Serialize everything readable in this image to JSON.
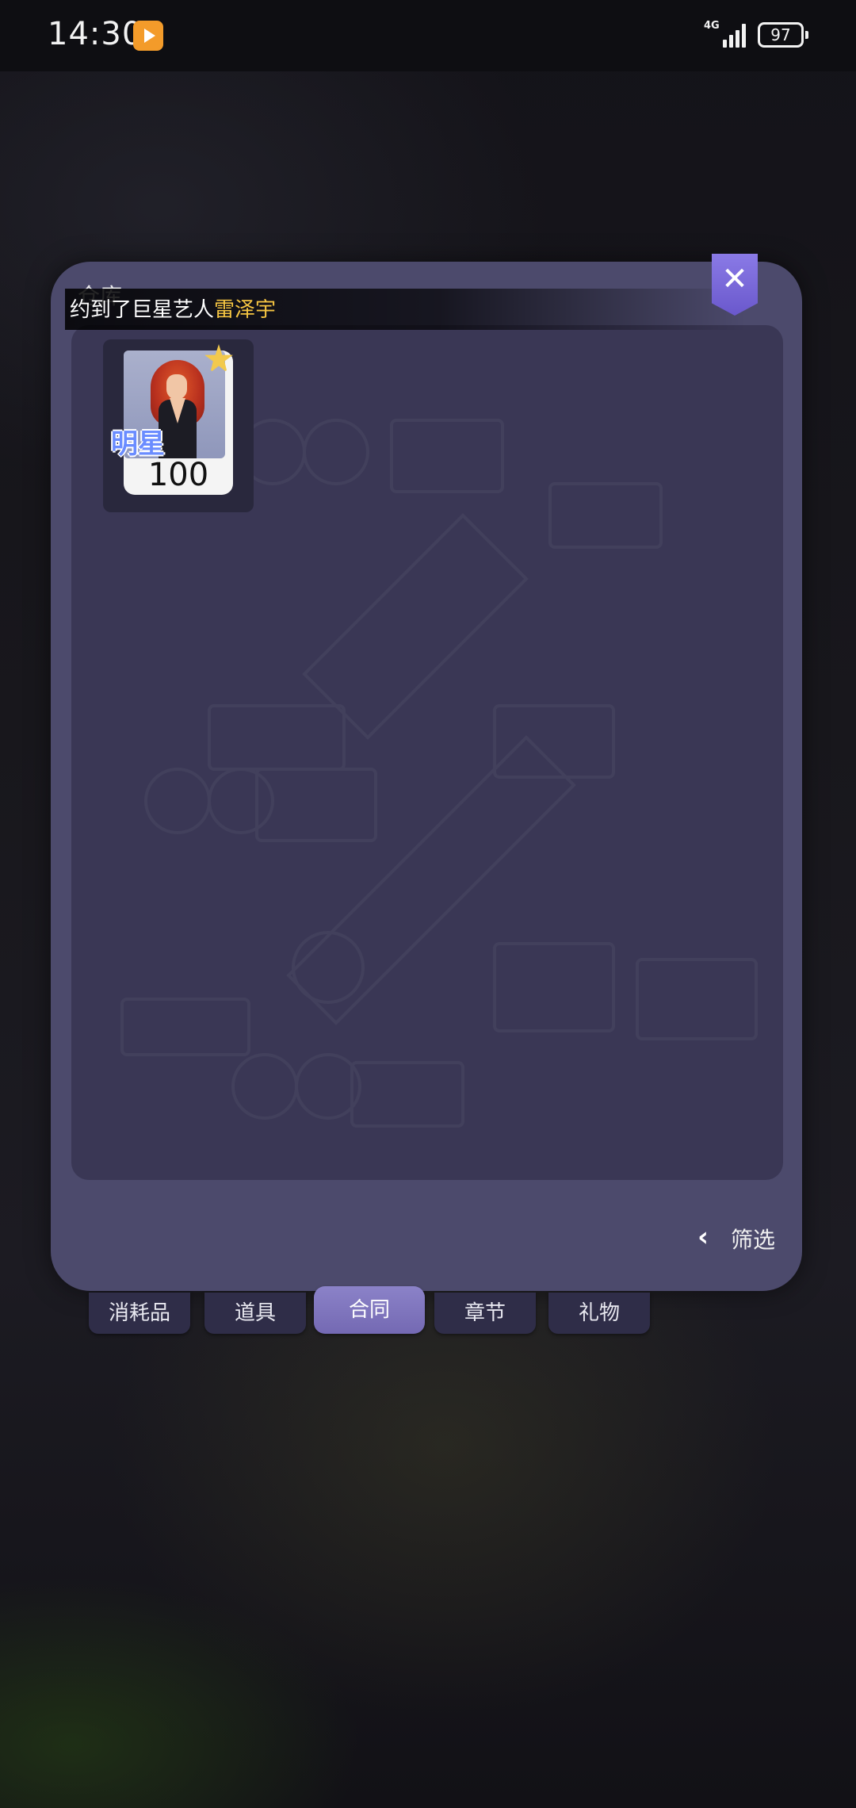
{
  "status_bar": {
    "time": "14:30",
    "network": "4G",
    "battery": "97"
  },
  "panel": {
    "title": "仓库",
    "ticker_prefix": "约到了巨星艺人",
    "ticker_highlight": "雷泽宇",
    "close_icon": "close-icon"
  },
  "items": [
    {
      "badge": "明星",
      "count": "100"
    }
  ],
  "filter": {
    "label": "筛选"
  },
  "tabs": [
    {
      "label": "消耗品",
      "active": false
    },
    {
      "label": "道具",
      "active": false
    },
    {
      "label": "合同",
      "active": true
    },
    {
      "label": "章节",
      "active": false
    },
    {
      "label": "礼物",
      "active": false
    }
  ],
  "colors": {
    "accent": "#7469b3",
    "highlight": "#f5c542",
    "badge": "#6a8cff"
  }
}
